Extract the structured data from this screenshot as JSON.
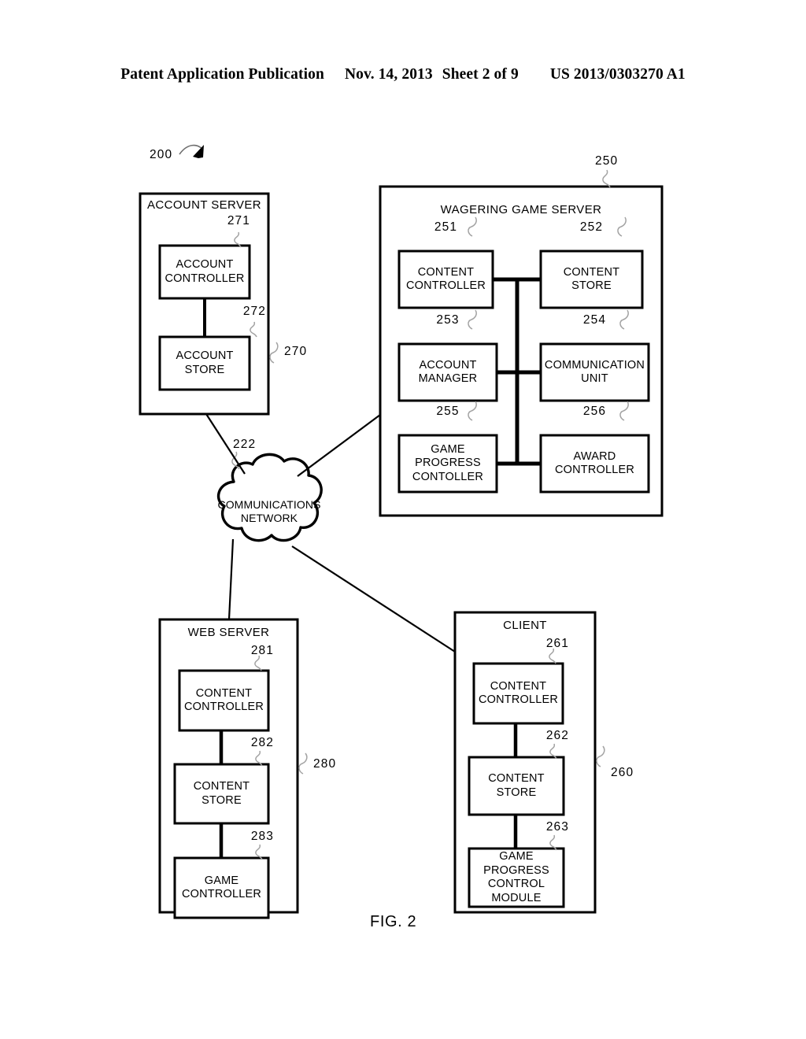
{
  "header": {
    "publication": "Patent Application Publication",
    "date": "Nov. 14, 2013",
    "sheet": "Sheet 2 of 9",
    "patent_number": "US 2013/0303270 A1"
  },
  "figure": {
    "caption": "FIG. 2",
    "system_ref": "200"
  },
  "nodes": {
    "account_server": {
      "title": "ACCOUNT SERVER",
      "ref": "270",
      "children": [
        {
          "label": "ACCOUNT\nCONTROLLER",
          "ref": "271"
        },
        {
          "label": "ACCOUNT\nSTORE",
          "ref": "272"
        }
      ]
    },
    "wagering_game_server": {
      "title": "WAGERING GAME SERVER",
      "ref": "250",
      "children": [
        {
          "label": "CONTENT\nCONTROLLER",
          "ref": "251"
        },
        {
          "label": "CONTENT\nSTORE",
          "ref": "252"
        },
        {
          "label": "ACCOUNT\nMANAGER",
          "ref": "253"
        },
        {
          "label": "COMMUNICATION\nUNIT",
          "ref": "254"
        },
        {
          "label": "GAME\nPROGRESS\nCONTOLLER",
          "ref": "255"
        },
        {
          "label": "AWARD\nCONTROLLER",
          "ref": "256"
        }
      ]
    },
    "communications_network": {
      "title": "COMMUNICATIONS\nNETWORK",
      "ref": "222"
    },
    "web_server": {
      "title": "WEB SERVER",
      "ref": "280",
      "children": [
        {
          "label": "CONTENT\nCONTROLLER",
          "ref": "281"
        },
        {
          "label": "CONTENT\nSTORE",
          "ref": "282"
        },
        {
          "label": "GAME\nCONTROLLER",
          "ref": "283"
        }
      ]
    },
    "client": {
      "title": "CLIENT",
      "ref": "260",
      "children": [
        {
          "label": "CONTENT\nCONTROLLER",
          "ref": "261"
        },
        {
          "label": "CONTENT\nSTORE",
          "ref": "262"
        },
        {
          "label": "GAME\nPROGRESS\nCONTROL\nMODULE",
          "ref": "263"
        }
      ]
    }
  },
  "colors": {
    "ink": "#000000",
    "paper": "#ffffff",
    "leader": "#9a9a9a"
  }
}
